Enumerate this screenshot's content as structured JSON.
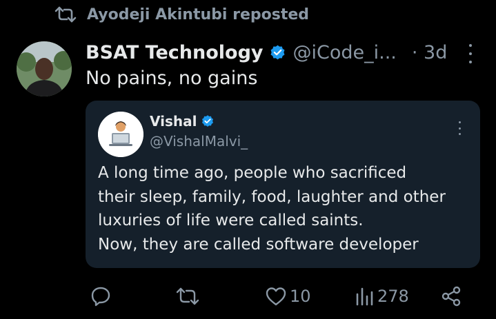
{
  "repost": {
    "text": "Ayodeji Akintubi reposted"
  },
  "post": {
    "author_name": "BSAT Technology",
    "handle": "@iCode_i...",
    "time": "· 3d",
    "text": "No pains, no gains"
  },
  "quote": {
    "author_name": "Vishal",
    "handle": "@VishalMalvi_",
    "lines": [
      "A long time ago, people who sacrificed",
      "their sleep, family, food, laughter and other",
      "luxuries of life were called saints.",
      "Now, they are called software developer"
    ]
  },
  "actions": {
    "likes": "10",
    "views": "278"
  },
  "colors": {
    "background": "#000000",
    "card": "#15202b",
    "text": "#e7e9ea",
    "muted": "#8b98a5",
    "verified": "#1d9bf0"
  }
}
